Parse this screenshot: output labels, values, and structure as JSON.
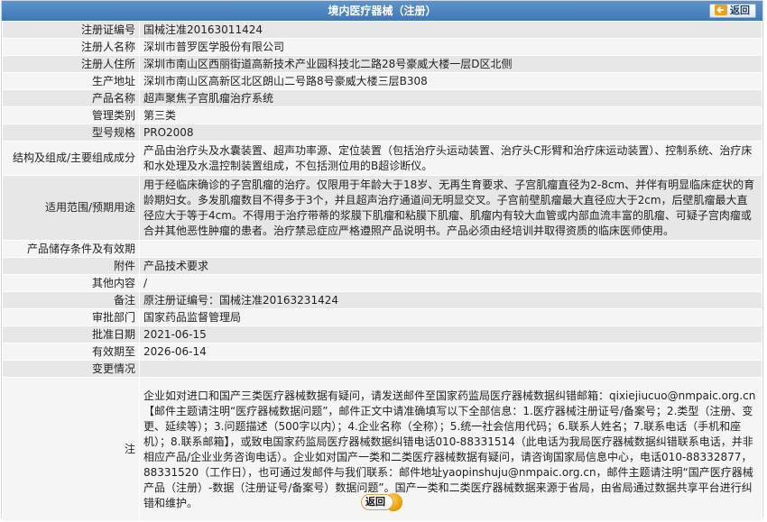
{
  "header": {
    "title": "境内医疗器械（注册）",
    "back_label": "返回"
  },
  "rows": [
    {
      "label": "注册证编号",
      "value": "国械注准20163011424"
    },
    {
      "label": "注册人名称",
      "value": "深圳市普罗医学股份有限公司"
    },
    {
      "label": "注册人住所",
      "value": "深圳市南山区西丽街道高新技术产业园科技北二路28号豪威大楼一层D区北侧"
    },
    {
      "label": "生产地址",
      "value": "深圳市南山区高新区北区朗山二号路8号豪威大楼三层B308"
    },
    {
      "label": "产品名称",
      "value": "超声聚焦子宫肌瘤治疗系统"
    },
    {
      "label": "管理类别",
      "value": "第三类"
    },
    {
      "label": "型号规格",
      "value": "PRO2008"
    },
    {
      "label": "结构及组成/主要组成成分",
      "value": "产品由治疗头及水囊装置、超声功率源、定位装置（包括治疗头运动装置、治疗头C形臂和治疗床运动装置）、控制系统、治疗床和水处理及水温控制装置组成，不包括测位用的B超诊断仪。"
    },
    {
      "label": "适用范围/预期用途",
      "value": "用于经临床确诊的子宫肌瘤的治疗。仅限用于年龄大于18岁、无再生育要求、子宫肌瘤直径为2-8cm、并伴有明显临床症状的育龄期妇女。多发肌瘤数目不得多于3个，并且超声治疗通道间无明显交叉。子宫前壁肌瘤最大直径应大于2cm，后壁肌瘤最大直径应大于等于4cm。不得用于治疗带蒂的浆膜下肌瘤和粘膜下肌瘤、肌瘤内有较大血管或内部血流丰富的肌瘤、可疑子宫肉瘤或合并其他恶性肿瘤的患者。治疗禁忌症应严格遵照产品说明书。产品必须由经培训并取得资质的临床医师使用。"
    },
    {
      "label": "产品储存条件及有效期",
      "value": ""
    },
    {
      "label": "附件",
      "value": "产品技术要求"
    },
    {
      "label": "其他内容",
      "value": "/"
    },
    {
      "label": "备注",
      "value": "原注册证编号：国械注准20163231424"
    },
    {
      "label": "审批部门",
      "value": "国家药品监督管理局"
    },
    {
      "label": "批准日期",
      "value": "2021-06-15"
    },
    {
      "label": "有效期至",
      "value": "2026-06-14"
    },
    {
      "label": "变更情况",
      "value": ""
    }
  ],
  "note": {
    "label": "注",
    "text": "企业如对进口和国产三类医疗器械数据有疑问，请发送邮件至国家药监局医疗器械数据纠错邮箱：qixiejiucuo@nmpaic.org.cn【邮件主题请注明“医疗器械数据问题”，邮件正文中请准确填写以下全部信息：1.医疗器械注册证号/备案号；2.类型（注册、变更、延续等）；3.问题描述（500字以内）；4.企业名称（全称）；5.统一社会信用代码；6.联系人姓名；7.联系电话（手机和座机）；8.联系邮箱】，或致电国家药监局医疗器械数据纠错电话010-88331514（此电话为我局医疗器械数据纠错联系电话，并非相应产品/企业业务咨询电话）。企业如对国产一类和二类医疗器械数据有疑问，请咨询国家局信息中心，电话010-88332877，88331520（工作日），也可通过发邮件与我们联系：邮件地址yaopinshuju@nmpaic.org.cn，邮件主题请注明“国产医疗器械产品（注册）-数据（注册证号/备案号）数据问题”。国产一类和二类医疗器械数据来源于省局，由省局通过数据共享平台进行纠错和维护。"
  },
  "footer": {
    "back_label": "返回"
  }
}
